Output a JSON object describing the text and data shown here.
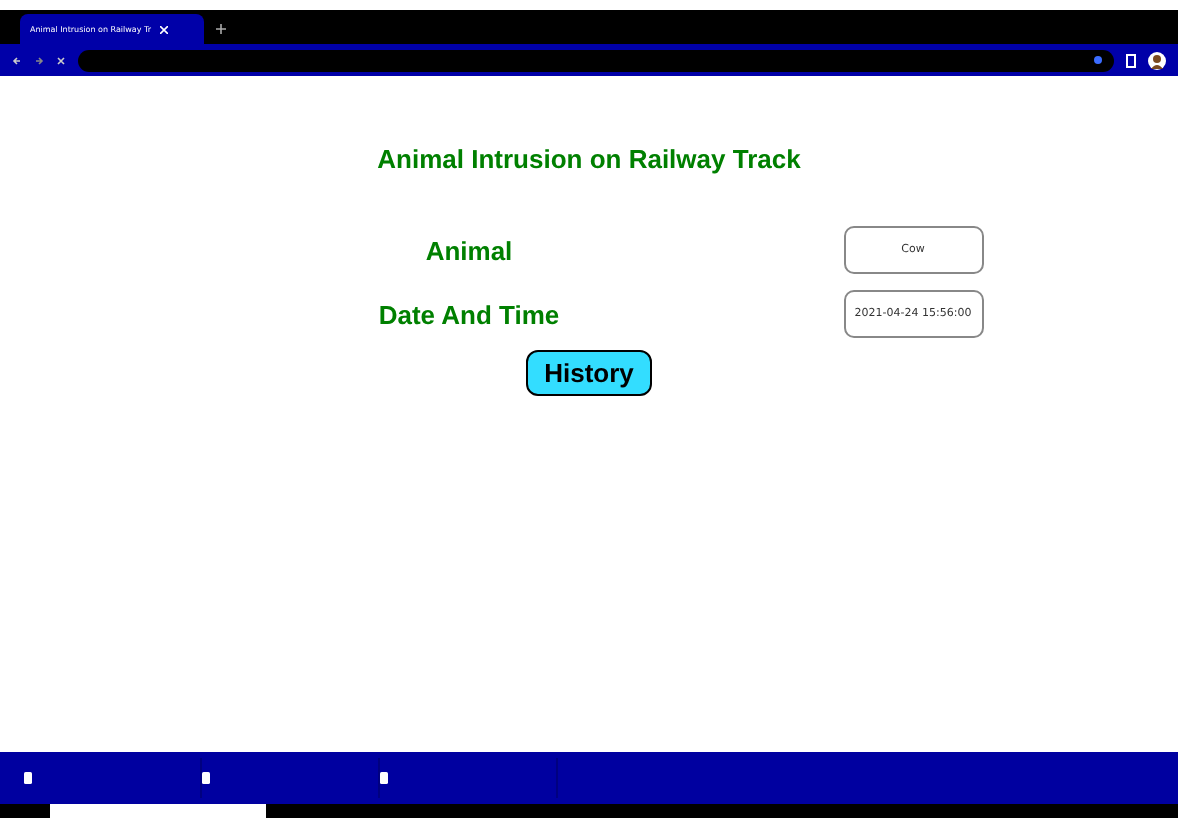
{
  "browser": {
    "tab_title": "Animal Intrusion on Railway Tr"
  },
  "page": {
    "heading": "Animal Intrusion on Railway Track",
    "fields": [
      {
        "label": "Animal",
        "value": "Cow"
      },
      {
        "label": "Date And Time",
        "value": "2021-04-24 15:56:00"
      }
    ],
    "button": "History"
  },
  "downloads": {
    "items": [
      {
        "kind": "file"
      },
      {
        "kind": "file"
      },
      {
        "kind": "file"
      }
    ]
  }
}
